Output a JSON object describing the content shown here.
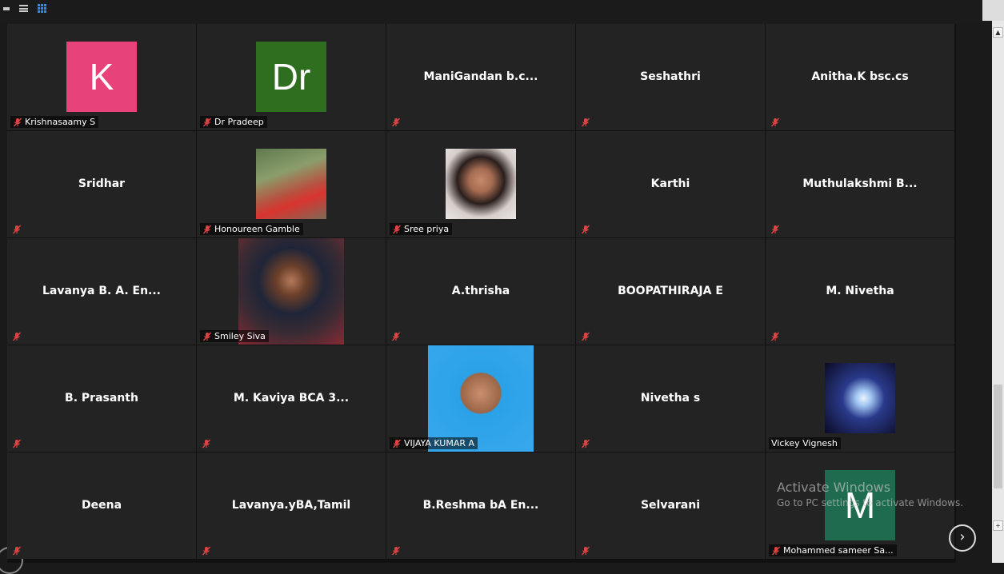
{
  "participants": [
    {
      "name": "K",
      "label": "Krishnasaamy S",
      "type": "letter",
      "color": "#e8427a"
    },
    {
      "name": "Dr",
      "label": "Dr Pradeep",
      "type": "letter",
      "color": "#2f6e1f"
    },
    {
      "name": "ManiGandan  b.c...",
      "label": "",
      "type": "text"
    },
    {
      "name": "Seshathri",
      "label": "",
      "type": "text"
    },
    {
      "name": "Anitha.K bsc.cs",
      "label": "",
      "type": "text"
    },
    {
      "name": "Sridhar",
      "label": "",
      "type": "text"
    },
    {
      "name": "",
      "label": "Honoureen Gamble",
      "type": "photo"
    },
    {
      "name": "",
      "label": "Sree priya",
      "type": "photo"
    },
    {
      "name": "Karthi",
      "label": "",
      "type": "text"
    },
    {
      "name": "Muthulakshmi  B...",
      "label": "",
      "type": "text"
    },
    {
      "name": "Lavanya B. A. En...",
      "label": "",
      "type": "text"
    },
    {
      "name": "",
      "label": "Smiley Siva",
      "type": "photo-lg"
    },
    {
      "name": "A.thrisha",
      "label": "",
      "type": "text"
    },
    {
      "name": "BOOPATHIRAJA E",
      "label": "",
      "type": "text"
    },
    {
      "name": "M. Nivetha",
      "label": "",
      "type": "text"
    },
    {
      "name": "B. Prasanth",
      "label": "",
      "type": "text"
    },
    {
      "name": "M. Kaviya BCA 3...",
      "label": "",
      "type": "text"
    },
    {
      "name": "",
      "label": "VIJAYA KUMAR A",
      "type": "photo-lg"
    },
    {
      "name": "Nivetha s",
      "label": "",
      "type": "text"
    },
    {
      "name": "",
      "label": "Vickey Vignesh",
      "type": "photo",
      "unmuted": true
    },
    {
      "name": "Deena",
      "label": "",
      "type": "text"
    },
    {
      "name": "Lavanya.yBA,Tamil",
      "label": "",
      "type": "text"
    },
    {
      "name": "B.Reshma  bA  En...",
      "label": "",
      "type": "text"
    },
    {
      "name": "Selvarani",
      "label": "",
      "type": "text"
    },
    {
      "name": "M",
      "label": "Mohammed sameer Sa...",
      "type": "letter",
      "color": "#1f6b4f"
    }
  ],
  "watermark": {
    "line1": "Activate Windows",
    "line2": "Go to PC settings to activate Windows."
  },
  "controls": {
    "next_page": "›"
  },
  "colors": {
    "muted_icon": "#e04343",
    "accent": "#2d8cff"
  }
}
